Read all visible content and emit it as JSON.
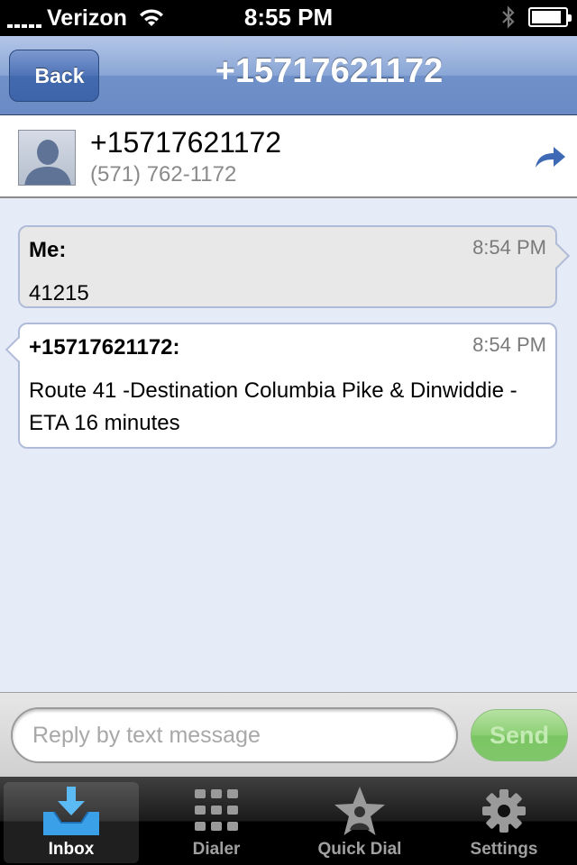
{
  "status_bar": {
    "carrier": "Verizon",
    "time": "8:55 PM",
    "battery_level": 0.9
  },
  "nav": {
    "back_label": "Back",
    "title": "+15717621172"
  },
  "contact": {
    "name": "+15717621172",
    "phone": "(571) 762-1172"
  },
  "messages": [
    {
      "sender": "Me:",
      "time": "8:54 PM",
      "text": "41215",
      "outgoing": true
    },
    {
      "sender": "+15717621172:",
      "time": "8:54 PM",
      "text": "Route 41 -Destination Columbia Pike & Dinwiddie -ETA 16 minutes",
      "outgoing": false
    }
  ],
  "reply": {
    "placeholder": "Reply by text message",
    "send_label": "Send"
  },
  "tabs": [
    {
      "label": "Inbox",
      "icon": "inbox-icon",
      "active": true
    },
    {
      "label": "Dialer",
      "icon": "dialer-icon",
      "active": false
    },
    {
      "label": "Quick Dial",
      "icon": "quick-dial-icon",
      "active": false
    },
    {
      "label": "Settings",
      "icon": "settings-icon",
      "active": false
    }
  ],
  "colors": {
    "nav_blue": "#6a8bc5",
    "send_green": "#7cc564",
    "message_bg": "#e6ebf8"
  }
}
